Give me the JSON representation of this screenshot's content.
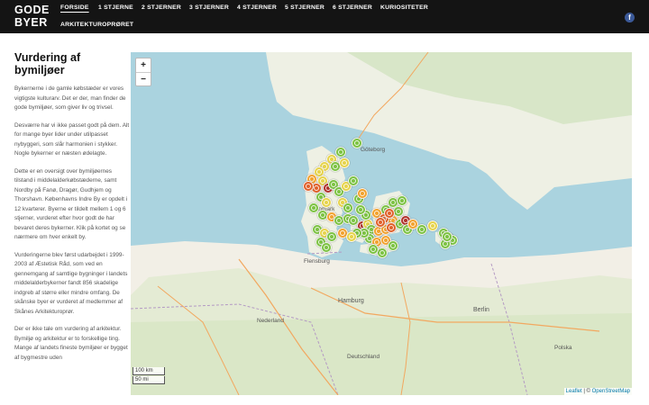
{
  "site": {
    "logo_line1": "GODE",
    "logo_line2": "BYER"
  },
  "nav": {
    "items": [
      "FORSIDE",
      "1 STJERNE",
      "2 STJERNER",
      "3 STJERNER",
      "4 STJERNER",
      "5 STJERNER",
      "6 STJERNER",
      "KURIOSITETER",
      "ARKITEKTUROPRØRET"
    ],
    "active": "FORSIDE"
  },
  "social": {
    "facebook_icon": "facebook-icon",
    "facebook_letter": "f"
  },
  "article": {
    "title": "Vurdering af bymiljøer",
    "paragraphs": [
      "Bykernerne i de gamle købstæder er vores vigtigste kulturarv. Det er der, man finder de gode bymiljøer, som giver liv og trivsel.",
      "Desværre har vi ikke passet godt på dem. Alt for mange byer lider under utilpasset nybyggeri, som slår harmonien i stykker. Nogle bykerner er næsten ødelagte.",
      "Dette er en oversigt over bymiljøernes tilstand i middelalderkøbstæderne, samt Nordby på Fanø, Dragør, Gudhjem og Thorshavn. Københavns Indre By er opdelt i 12 kvarterer. Byerne er tildelt mellem 1 og 6 stjerner, vurderet efter hvor godt de har bevaret deres bykerner. Klik på kortet og se nærmere om hver enkelt by.",
      "Vurderingerne blev først udarbejdet i 1999-2003 af Æstetisk Råd, som ved en gennemgang af samtlige bygninger i landets middelalderbykerner fandt 856 skadelige indgreb af større eller mindre omfang. De skånske byer er vurderet af medlemmer af Skånes Arkitekturoprør.",
      "Der er ikke tale om vurdering af arkitektur. Bymiljø og arkitektur er to forskellige ting. Mange af landets fineste bymiljøer er bygget af bygmestre uden"
    ]
  },
  "map": {
    "zoom_in": "+",
    "zoom_out": "−",
    "scale_km": "100 km",
    "scale_mi": "50 mi",
    "attribution_leaflet": "Leaflet",
    "attribution_sep": " | © ",
    "attribution_osm": "OpenStreetMap",
    "place_labels": [
      "Göteborg",
      "Danmark",
      "Flensburg",
      "Hamburg",
      "Nederland",
      "Deutschland",
      "Polska",
      "Berlin"
    ],
    "rating_colors": {
      "good": "#7cc242",
      "mid": "#e6d34a",
      "fair": "#f2a22e",
      "poor": "#e0602a",
      "bad": "#b0312a"
    }
  }
}
